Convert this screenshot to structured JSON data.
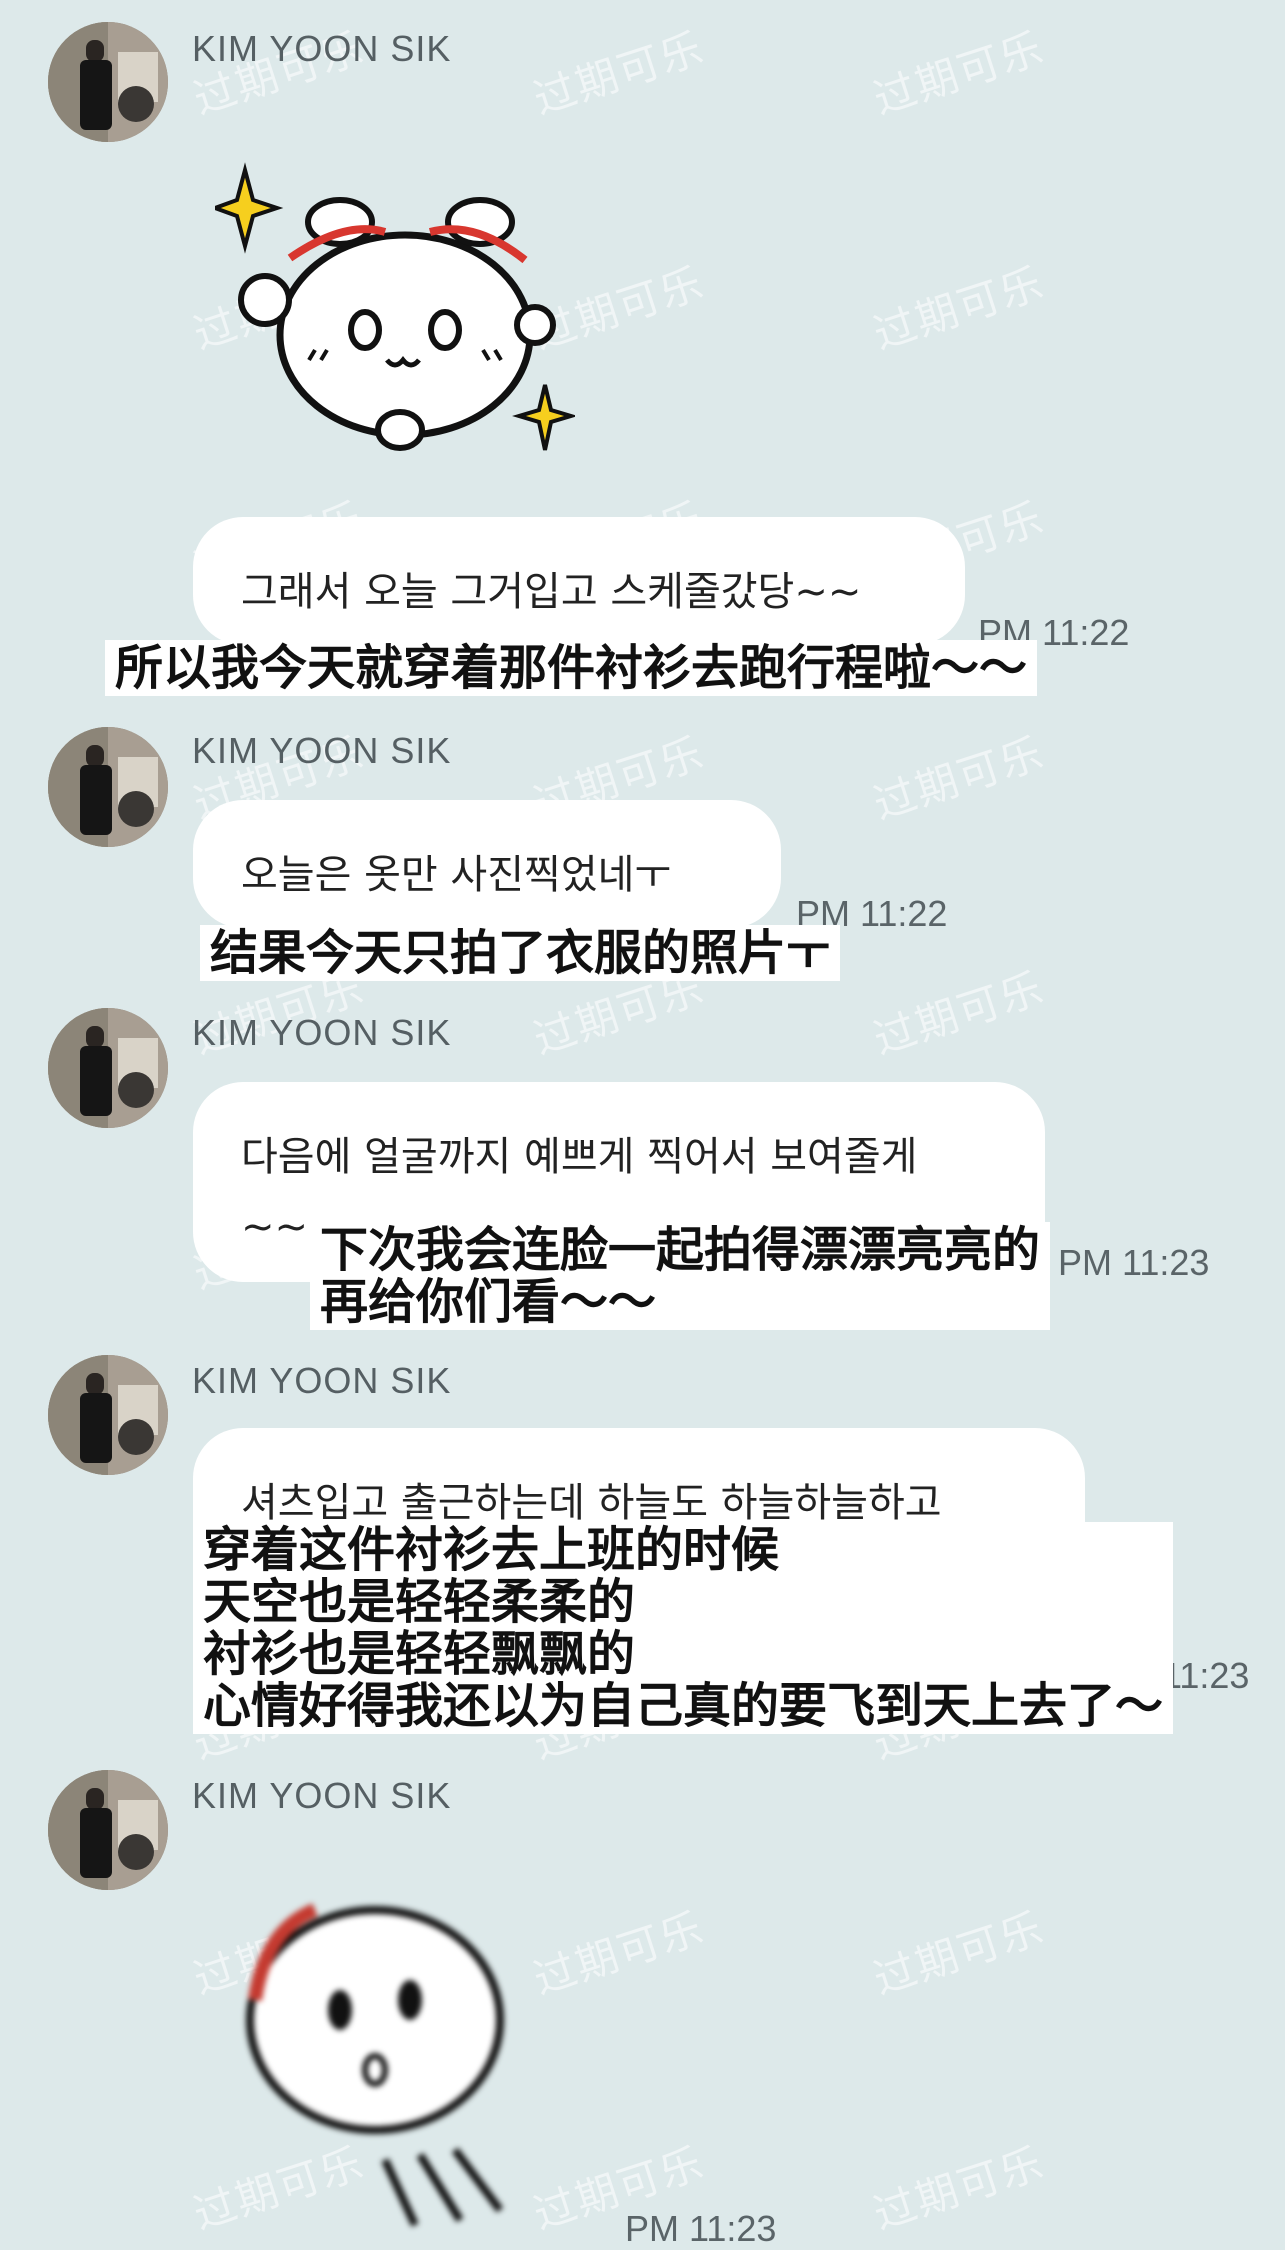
{
  "watermark": "过期可乐",
  "colors": {
    "background": "#dde9ea",
    "bubble": "#ffffff",
    "name": "#555f63",
    "time": "#5a6468"
  },
  "messages": [
    {
      "sender": "KIM YOON SIK",
      "type": "sticker",
      "sticker": "happy-bunny-sticker"
    },
    {
      "text": "그래서 오늘 그거입고 스케줄갔당~~",
      "time": "PM 11:22",
      "translation": "所以我今天就穿着那件衬衫去跑行程啦～～"
    },
    {
      "sender": "KIM YOON SIK",
      "text": "오늘은 옷만 사진찍었네ㅜ",
      "time": "PM 11:22",
      "translation": "结果今天只拍了衣服的照片ㅜ"
    },
    {
      "sender": "KIM YOON SIK",
      "text_line1": "다음에 얼굴까지 예쁘게 찍어서 보여줄게",
      "text_line2": "~~",
      "time": "PM 11:23",
      "translation_line1": "下次我会连脸一起拍得漂漂亮亮的",
      "translation_line2": "再给你们看～～"
    },
    {
      "sender": "KIM YOON SIK",
      "text": "셔츠입고 출근하는데 하늘도 하늘하늘하고",
      "time": "PM 11:23",
      "translation_lines": [
        "穿着这件衬衫去上班的时候",
        "天空也是轻轻柔柔的",
        "衬衫也是轻轻飘飘的",
        "心情好得我还以为自己真的要飞到天上去了～"
      ]
    },
    {
      "sender": "KIM YOON SIK",
      "type": "sticker",
      "sticker": "flying-bunny-sticker",
      "time": "PM 11:23"
    }
  ]
}
